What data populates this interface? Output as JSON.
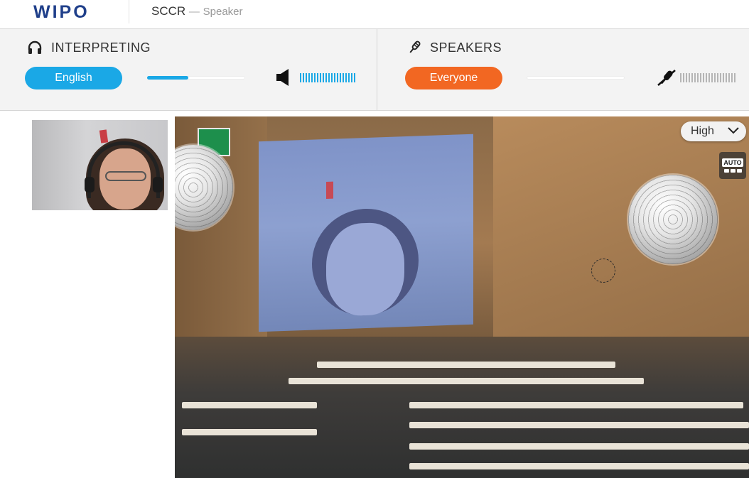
{
  "header": {
    "logo_text": "WIPO",
    "title": "SCCR",
    "title_dash": "—",
    "subtitle": "Speaker"
  },
  "interpreting": {
    "label": "INTERPRETING",
    "icon": "headphones-icon",
    "language_button": "English",
    "volume_level": 0.42,
    "volume_icon": "speaker-icon",
    "meter_active": true,
    "accent_color": "#1aa8e6"
  },
  "speakers": {
    "label": "SPEAKERS",
    "icon": "microphone-icon",
    "filter_button": "Everyone",
    "volume_level": 0,
    "volume_icon": "microphone-muted-icon",
    "meter_active": false,
    "accent_color": "#f26722"
  },
  "video": {
    "quality_label": "High",
    "quality_icon": "chevron-down-icon",
    "auto_label": "AUTO"
  }
}
